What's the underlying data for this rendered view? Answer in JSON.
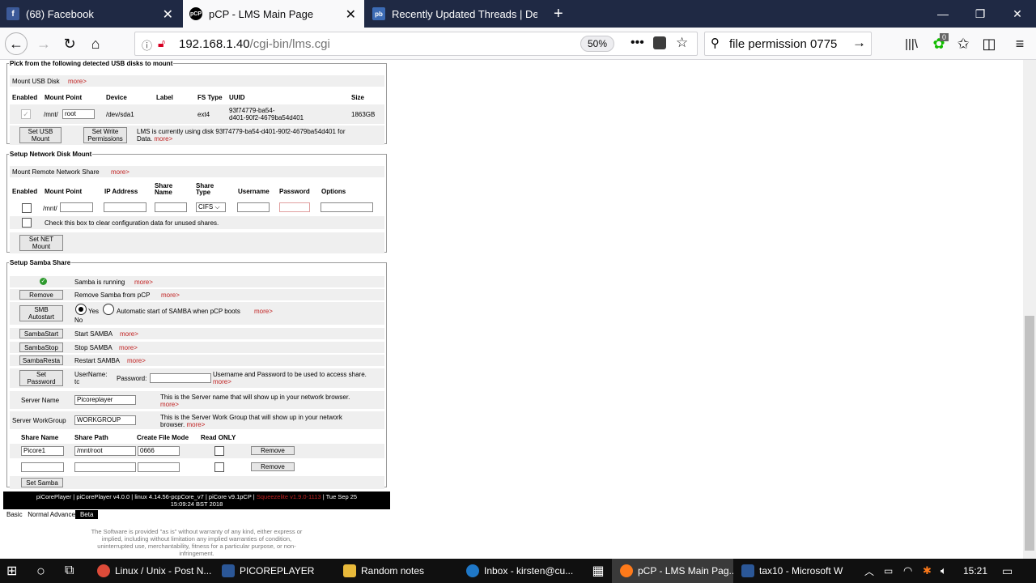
{
  "tabs": [
    {
      "title": "(68) Facebook",
      "icon": "facebook-icon"
    },
    {
      "title": "pCP - LMS Main Page",
      "icon": "pcp-icon"
    },
    {
      "title": "Recently Updated Threads | De",
      "icon": "forum-icon"
    }
  ],
  "favicon_pcp_text": "pCP",
  "favicon_fb_text": "f",
  "favicon_forum_text": "pb",
  "url": {
    "host": "192.168.1.40",
    "path": "/cgi-bin/lms.cgi"
  },
  "zoom": "50%",
  "search": {
    "query": "file permission 0775"
  },
  "badge": "0",
  "usb": {
    "legend": "Pick from the following detected USB disks to mount",
    "mount_label": "Mount USB Disk",
    "more": "more>",
    "headers": {
      "enabled": "Enabled",
      "mount_point": "Mount Point",
      "device": "Device",
      "label": "Label",
      "fstype": "FS Type",
      "uuid": "UUID",
      "size": "Size"
    },
    "mnt_prefix": "/mnt/",
    "mount_value": "root",
    "device": "/dev/sda1",
    "fstype": "ext4",
    "uuid_line1": "93f74779-ba54-",
    "uuid_line2": "d401-90f2-4679ba54d401",
    "size": "1863GB",
    "set_mount_l1": "Set USB",
    "set_mount_l2": "Mount",
    "set_write_l1": "Set Write",
    "set_write_l2": "Permissions",
    "note_line1": "LMS is currently using disk 93f74779-ba54-d401-90f2-4679ba54d401 for",
    "note_line2": "Data."
  },
  "net": {
    "legend": "Setup Network Disk Mount",
    "mount_label": "Mount Remote Network Share",
    "more": "more>",
    "headers": {
      "enabled": "Enabled",
      "mount_point": "Mount Point",
      "ip": "IP Address",
      "share_name_1": "Share",
      "share_name_2": "Name",
      "share_type_1": "Share",
      "share_type_2": "Type",
      "username": "Username",
      "password": "Password",
      "options": "Options"
    },
    "mnt_prefix": "/mnt/",
    "share_type": "CIFS",
    "clear_text": "Check this box to clear configuration data for unused shares.",
    "set_net_l1": "Set NET",
    "set_net_l2": "Mount"
  },
  "samba": {
    "legend": "Setup Samba Share",
    "running": "Samba is running",
    "more": "more>",
    "remove_btn": "Remove",
    "remove_text": "Remove Samba from pCP",
    "smb_auto_l1": "SMB",
    "smb_auto_l2": "Autostart",
    "yes": "Yes",
    "no": "No",
    "auto_text": "Automatic start of SAMBA when pCP boots",
    "start_btn": "SambaStart",
    "start_text": "Start SAMBA",
    "stop_btn": "SambaStop",
    "stop_text": "Stop SAMBA",
    "restart_btn": "SambaResta",
    "restart_text": "Restart SAMBA",
    "setpw_l1": "Set",
    "setpw_l2": "Password",
    "username_label": "UserName:",
    "username_value": "tc",
    "password_label": "Password:",
    "pw_note": "Username and Password to be used to access share.",
    "server_name_label": "Server Name",
    "server_name_value": "Picoreplayer",
    "server_name_note": "This is the Server name that will show up in your network browser.",
    "workgroup_label": "Server WorkGroup",
    "workgroup_value": "WORKGROUP",
    "workgroup_note_1": "This is the Server Work Group that will show up in your network",
    "workgroup_note_2": "browser.",
    "share_headers": {
      "name": "Share Name",
      "path": "Share Path",
      "mode": "Create File Mode",
      "ro": "Read ONLY"
    },
    "share1": {
      "name": "Picore1",
      "path": "/mnt/root",
      "mode": "0666"
    },
    "share_remove": "Remove",
    "set_samba": "Set Samba"
  },
  "footer": {
    "line1_pre": "piCorePlayer | piCorePlayer v4.0.0 | linux 4.14.56-pcpCore_v7 | piCore v9.1pCP | ",
    "line1_sq": "Squeezelite v1.9.0-1113",
    "line1_post": " | Tue Sep 25",
    "line2": "15:09:24 BST 2018"
  },
  "modes": {
    "basic": "Basic",
    "normal": "Normal",
    "advanced": "Advance",
    "beta": "Beta"
  },
  "disclaimer": [
    "The Software is provided \"as is\" without warranty of any kind, either express or",
    "implied, including without limitation any implied warranties of condition,",
    "uninterrupted use, merchantability, fitness for a particular purpose, or non-",
    "infringement."
  ],
  "taskbar": {
    "items": [
      "Linux / Unix - Post N...",
      "PICOREPLAYER",
      "Random notes",
      "Inbox - kirsten@cu...",
      "pCP - LMS Main Pag...",
      "tax10 - Microsoft W"
    ],
    "clock": "15:21"
  }
}
